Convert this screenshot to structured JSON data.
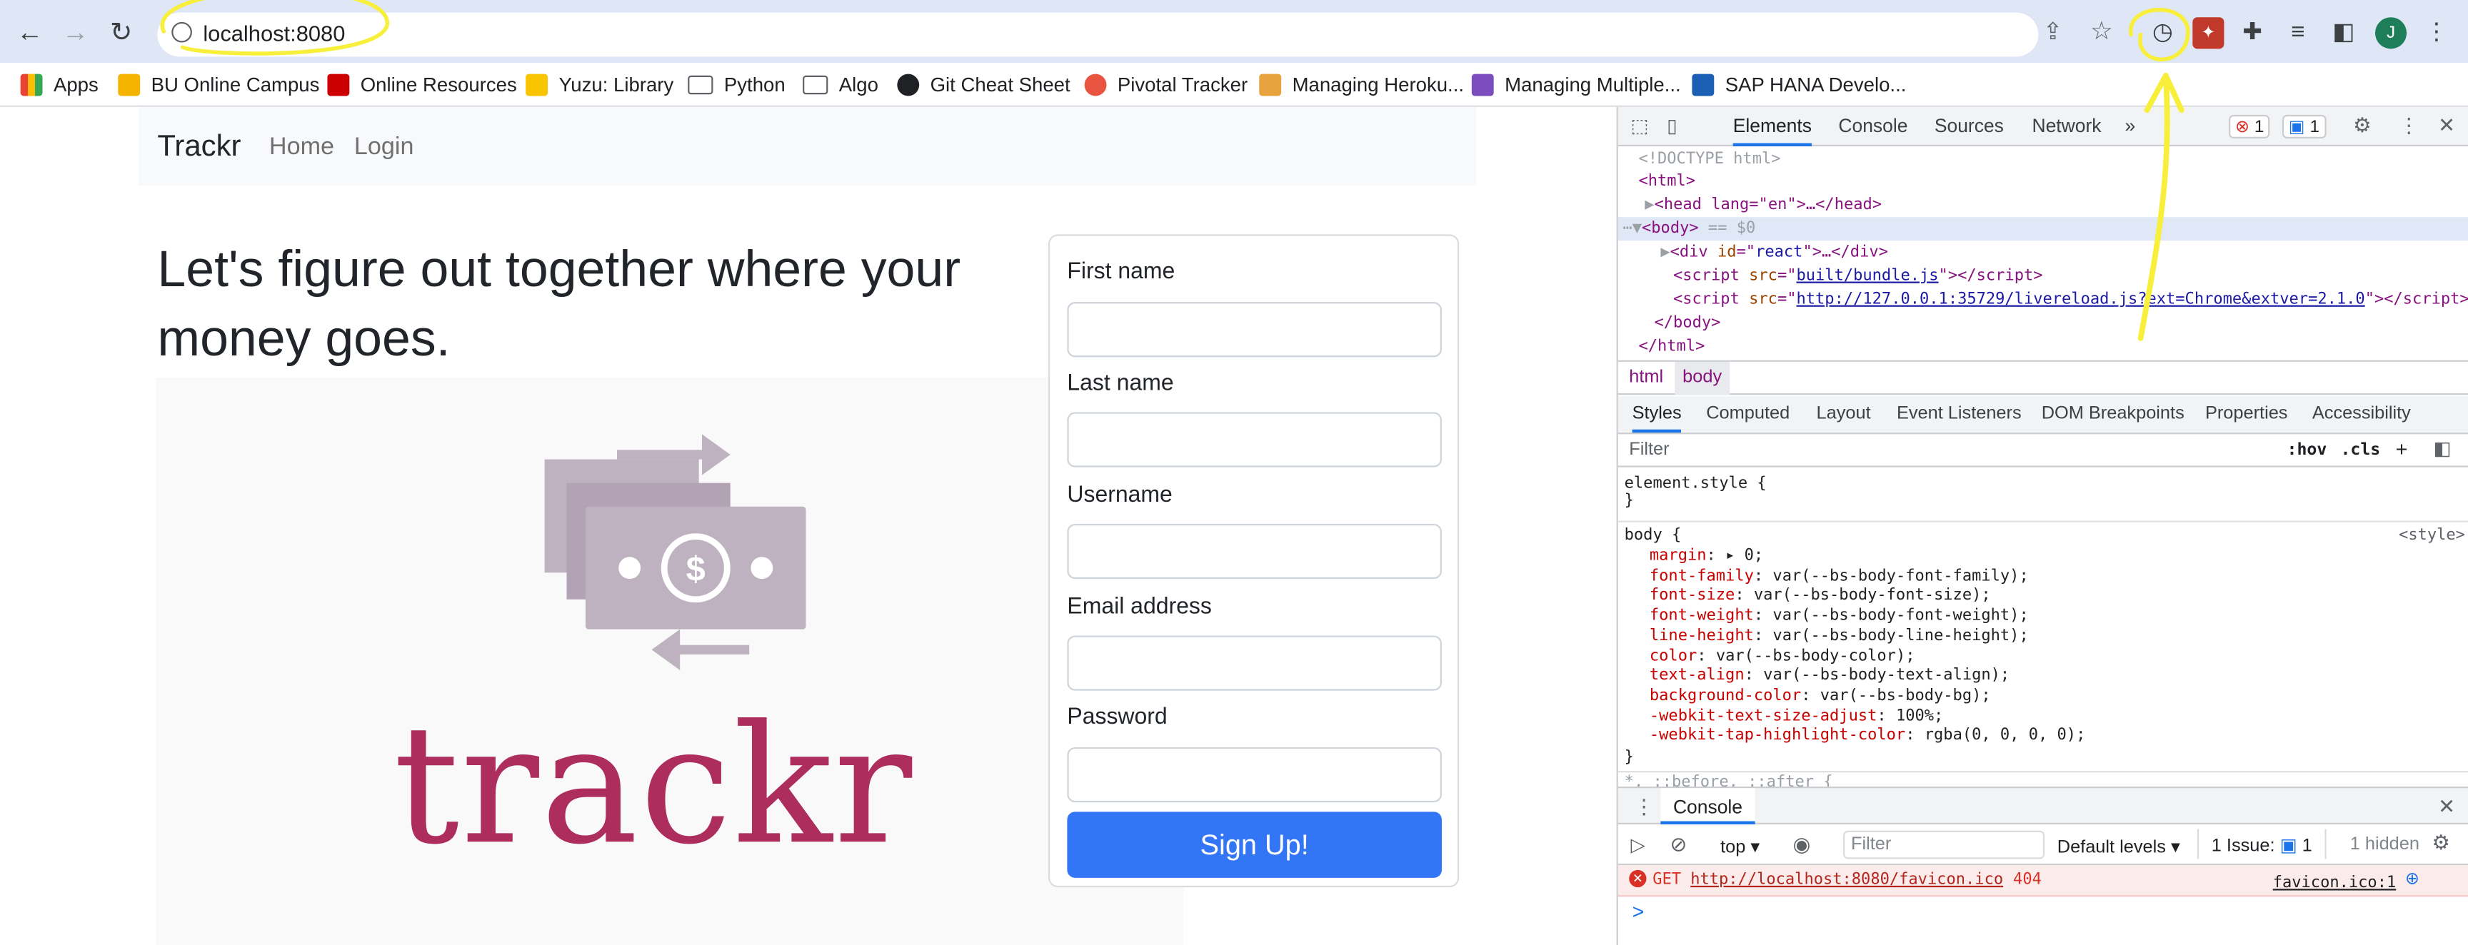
{
  "browser": {
    "url_host": "localhost",
    "url_port": ":8080",
    "profile_initial": "J",
    "bookmarks": [
      {
        "label": "Apps",
        "color": "#ea4335"
      },
      {
        "label": "BU Online Campus",
        "color": "#f4b400"
      },
      {
        "label": "Online Resources",
        "color": "#cc0000"
      },
      {
        "label": "Yuzu: Library",
        "color": "#f9c500"
      },
      {
        "label": "Python",
        "color": "folder"
      },
      {
        "label": "Algo",
        "color": "folder"
      },
      {
        "label": "Git Cheat Sheet",
        "color": "#202124"
      },
      {
        "label": "Pivotal Tracker",
        "color": "#e8543f"
      },
      {
        "label": "Managing Heroku...",
        "color": "#e8a33f"
      },
      {
        "label": "Managing Multiple...",
        "color": "#7c4dbd"
      },
      {
        "label": "SAP HANA Develo...",
        "color": "#1a5fb4"
      }
    ]
  },
  "app": {
    "brand": "Trackr",
    "nav": [
      "Home",
      "Login"
    ],
    "headline": "Let's figure out together where your money goes.",
    "logo_text": "trackr",
    "form": {
      "fields": [
        "First name",
        "Last name",
        "Username",
        "Email address",
        "Password"
      ],
      "submit": "Sign Up!"
    }
  },
  "devtools": {
    "tabs": [
      "Elements",
      "Console",
      "Sources",
      "Network",
      "»"
    ],
    "error_count": "1",
    "message_count": "1",
    "breadcrumbs": [
      "html",
      "body"
    ],
    "subtabs": [
      "Styles",
      "Computed",
      "Layout",
      "Event Listeners",
      "DOM Breakpoints",
      "Properties",
      "Accessibility"
    ],
    "filter_placeholder": "Filter",
    "hov": ":hov",
    "cls": ".cls",
    "dom": {
      "doctype": "<!DOCTYPE html>",
      "html_open": "<html>",
      "head": "<head lang=\"en\">…</head>",
      "body_marker": "== $0",
      "div_id": "react",
      "script1_src": "built/bundle.js",
      "script2_src": "http://127.0.0.1:35729/livereload.js?ext=Chrome&extver=2.1.0"
    },
    "styles": {
      "element_style": "element.style {",
      "body_selector": "body {",
      "source": "<style>",
      "props": [
        {
          "name": "margin",
          "value": "▸ 0;"
        },
        {
          "name": "font-family",
          "value": "var(--bs-body-font-family);"
        },
        {
          "name": "font-size",
          "value": "var(--bs-body-font-size);"
        },
        {
          "name": "font-weight",
          "value": "var(--bs-body-font-weight);"
        },
        {
          "name": "line-height",
          "value": "var(--bs-body-line-height);"
        },
        {
          "name": "color",
          "value": "var(--bs-body-color);"
        },
        {
          "name": "text-align",
          "value": "var(--bs-body-text-align);"
        },
        {
          "name": "background-color",
          "value": "var(--bs-body-bg);"
        },
        {
          "name": "-webkit-text-size-adjust",
          "value": "100%;"
        },
        {
          "name": "-webkit-tap-highlight-color",
          "value": "rgba(0, 0, 0, 0);"
        }
      ],
      "next_rule": "*, ::before, ::after {"
    },
    "console": {
      "title": "Console",
      "context": "top",
      "filter_placeholder": "Filter",
      "levels": "Default levels",
      "issues_label": "1 Issue:",
      "issues_count": "1",
      "hidden": "1 hidden",
      "error_method": "GET",
      "error_url": "http://localhost:8080/favicon.ico",
      "error_status": "404",
      "error_source": "favicon.ico:1",
      "prompt": ">"
    }
  },
  "colors": {
    "accent": "#3275f5",
    "logo": "#ad2d5c",
    "annotation": "#f7ef3a"
  }
}
